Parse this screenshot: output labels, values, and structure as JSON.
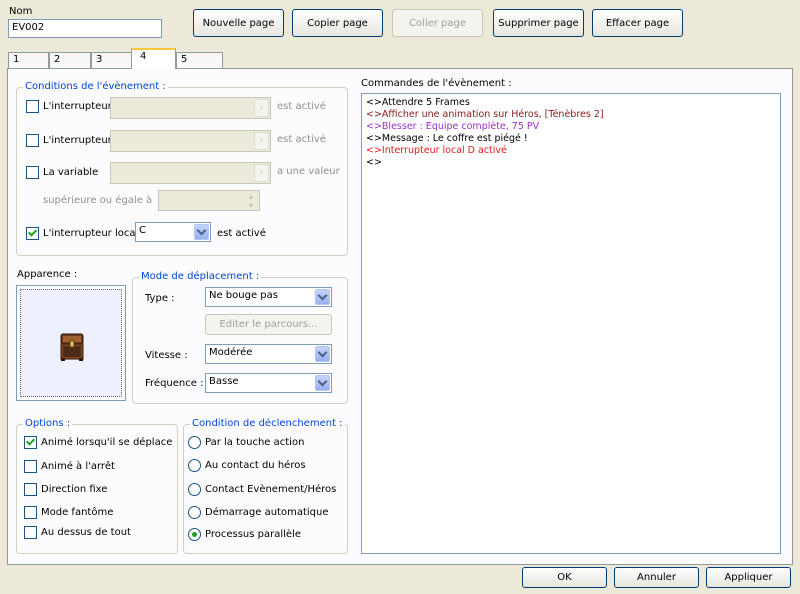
{
  "header": {
    "name_label": "Nom",
    "name_value": "EV002",
    "buttons": {
      "new_page": "Nouvelle page",
      "copy_page": "Copier page",
      "paste_page": "Coller page",
      "delete_page": "Supprimer page",
      "clear_page": "Effacer page"
    }
  },
  "tabs": [
    "1",
    "2",
    "3",
    "4",
    "5"
  ],
  "active_tab": "4",
  "conditions": {
    "title": "Conditions de l'évènement :",
    "switch1": {
      "label": "L'interrupteur",
      "suffix": "est activé",
      "checked": false
    },
    "switch2": {
      "label": "L'interrupteur",
      "suffix": "est activé",
      "checked": false
    },
    "variable": {
      "label": "La variable",
      "suffix": "a une valeur",
      "checked": false
    },
    "variable_compare": "supérieure ou égale à",
    "local_switch": {
      "label": "L'interrupteur local",
      "value": "C",
      "suffix": "est activé",
      "checked": true
    },
    "arrow_glyph": "›",
    "spin_up": "▴",
    "spin_down": "▾"
  },
  "appearance": {
    "label": "Apparence :",
    "sprite": "treasure-chest"
  },
  "movement": {
    "title": "Mode de déplacement :",
    "type_label": "Type :",
    "type_value": "Ne bouge pas",
    "route_button": "Editer le parcours...",
    "speed_label": "Vitesse :",
    "speed_value": "Modérée",
    "freq_label": "Fréquence :",
    "freq_value": "Basse"
  },
  "options": {
    "title": "Options :",
    "items": [
      {
        "label": "Animé lorsqu'il se déplace",
        "checked": true
      },
      {
        "label": "Animé à l'arrêt",
        "checked": false
      },
      {
        "label": "Direction fixe",
        "checked": false
      },
      {
        "label": "Mode fantôme",
        "checked": false
      },
      {
        "label": "Au dessus de tout",
        "checked": false
      }
    ]
  },
  "trigger": {
    "title": "Condition de déclenchement :",
    "items": [
      {
        "label": "Par la touche action",
        "selected": false
      },
      {
        "label": "Au contact du héros",
        "selected": false
      },
      {
        "label": "Contact Evènement/Héros",
        "selected": false
      },
      {
        "label": "Démarrage automatique",
        "selected": false
      },
      {
        "label": "Processus parallèle",
        "selected": true
      }
    ]
  },
  "commands": {
    "label": "Commandes de l'évènement :",
    "lines": [
      {
        "text": "<>Attendre 5 Frames",
        "color": "#000000"
      },
      {
        "text": "<>Afficher une animation sur Héros, [Ténèbres 2]",
        "color": "#8b1a1a"
      },
      {
        "text": "<>Blesser : Equipe complète, 75 PV",
        "color": "#9b30c8"
      },
      {
        "text": "<>Message : Le coffre est piégé !",
        "color": "#000000"
      },
      {
        "text": "<>Interrupteur local D activé",
        "color": "#e11b1b"
      },
      {
        "text": "<>",
        "color": "#000000"
      }
    ]
  },
  "footer": {
    "ok": "OK",
    "cancel": "Annuler",
    "apply": "Appliquer"
  }
}
